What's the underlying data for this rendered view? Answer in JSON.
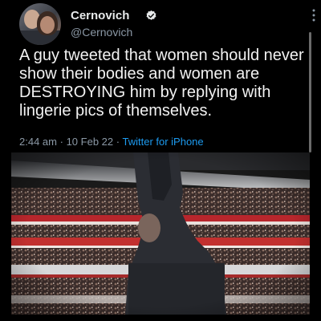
{
  "tweet": {
    "display_name": "Cernovich",
    "handle": "@Cernovich",
    "verified": true,
    "text": "A guy tweeted that women should never show their bodies and women are DESTROYING him by replying with lingerie pics of themselves.",
    "time": "2:44 am",
    "date": "10 Feb 22",
    "separator": "·",
    "source": "Twitter for iPhone"
  },
  "icons": {
    "verified": "verified-badge-icon",
    "more": "more-options-icon"
  },
  "colors": {
    "background": "#000000",
    "text": "#e7e9ea",
    "secondary": "#8b98a5",
    "link": "#1d9bf0",
    "verified": "#e7e9ea"
  }
}
